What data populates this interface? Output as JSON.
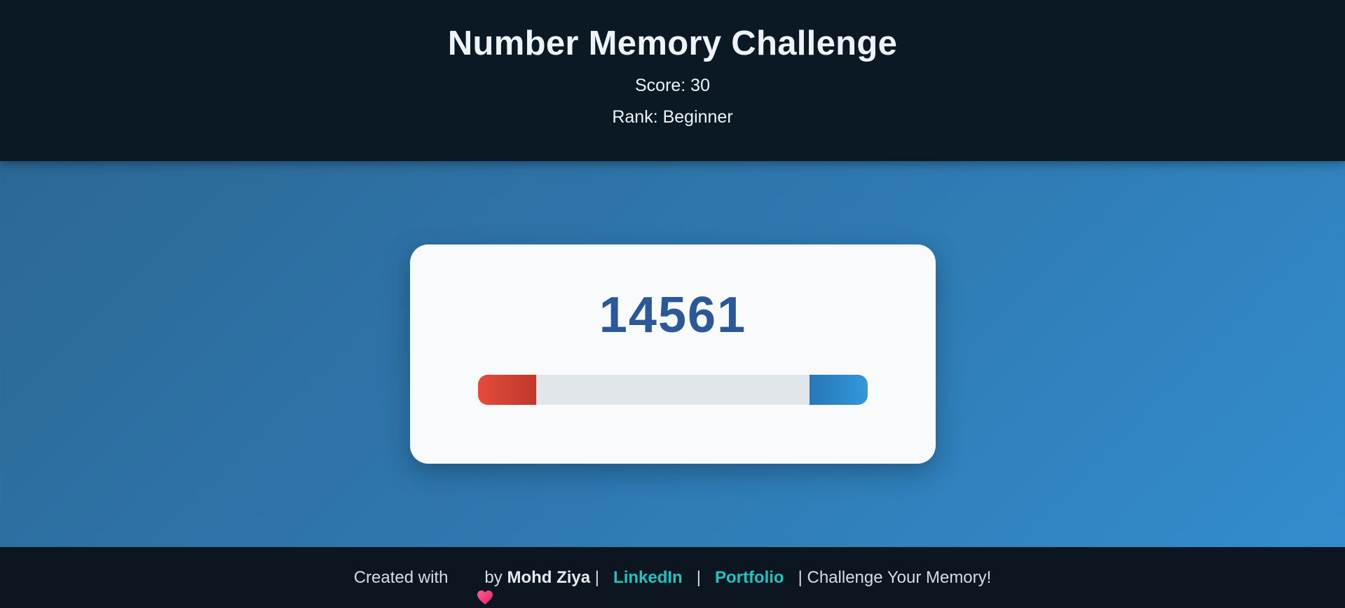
{
  "header": {
    "title": "Number Memory Challenge",
    "score_text": "Score: 30",
    "rank_text": "Rank: Beginner"
  },
  "game": {
    "display_number": "14561",
    "timer_bar": {
      "left_fill_fraction": 0.15,
      "right_fill_fraction": 0.15,
      "left_color": "#e44b3c",
      "right_color": "#3498db",
      "track_color": "#e1e6ea"
    }
  },
  "footer": {
    "created_with": "Created with",
    "heart_icon": "heart-icon",
    "by": "by",
    "author": "Mohd Ziya",
    "sep1": "|",
    "linkedin_label": "LinkedIn",
    "sep2": "|",
    "portfolio_label": "Portfolio",
    "tagline": "| Challenge Your Memory!"
  },
  "colors": {
    "accent_link": "#1fc3c0",
    "number_color": "#2b5896",
    "header_bg": "#0b1924"
  }
}
